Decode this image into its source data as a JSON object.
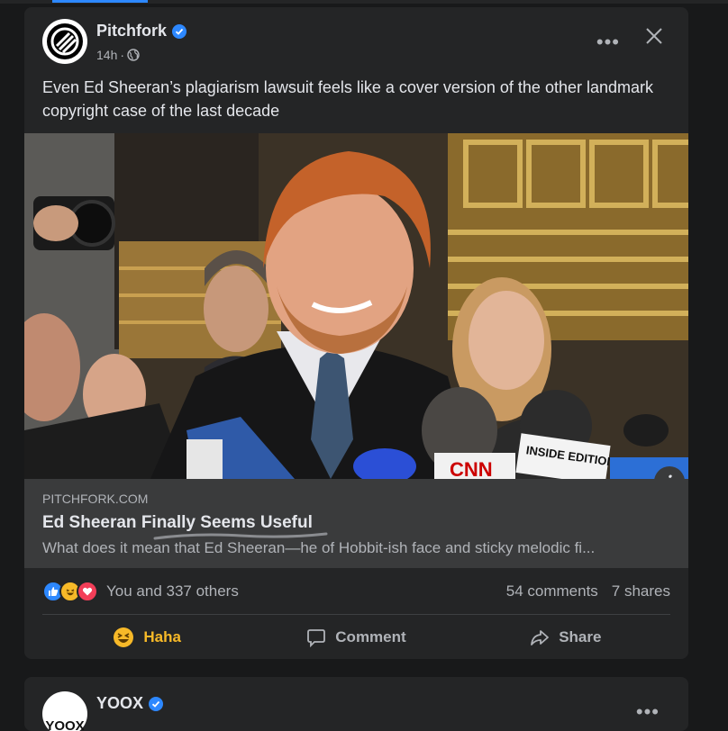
{
  "post": {
    "page_name": "Pitchfork",
    "time": "14h",
    "caption": "Even Ed Sheeran’s plagiarism lawsuit feels like a cover version of the other landmark copyright case of the last decade",
    "photo_signs": {
      "cnn": "CNN",
      "inside_edition": "INSIDE EDITION"
    },
    "link": {
      "domain": "PITCHFORK.COM",
      "title": "Ed Sheeran Finally Seems Useful",
      "description": "What does it mean that Ed Sheeran—he of Hobbit-ish face and sticky melodic fi..."
    },
    "reactions": {
      "icons": [
        "like-icon",
        "haha-icon",
        "love-icon"
      ],
      "summary": "You and 337 others",
      "comments": "54 comments",
      "shares": "7 shares"
    },
    "actions": {
      "haha": "Haha",
      "comment": "Comment",
      "share": "Share"
    }
  },
  "next_post": {
    "page_name": "YOOX",
    "avatar_text": "YOOX"
  },
  "colors": {
    "background": "#18191a",
    "card": "#242526",
    "link_box": "#3a3b3c",
    "accent_blue": "#2d88ff",
    "haha_yellow": "#f7b928",
    "love_red": "#f33e58",
    "text_primary": "#e4e6eb",
    "text_secondary": "#b0b3b8"
  }
}
